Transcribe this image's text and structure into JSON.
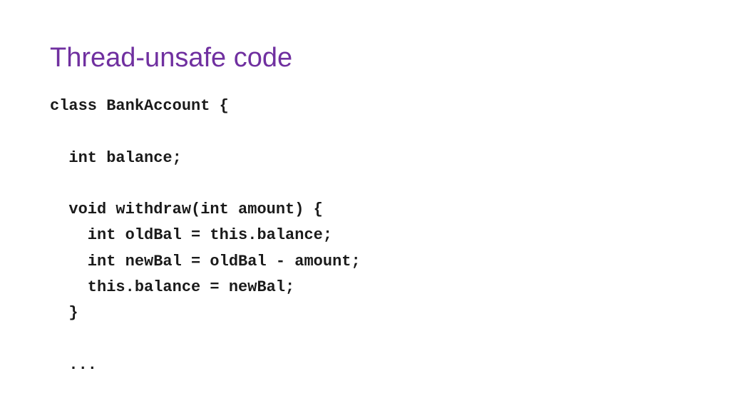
{
  "slide": {
    "title": "Thread-unsafe code",
    "code": "class BankAccount {\n\n  int balance;\n\n  void withdraw(int amount) {\n    int oldBal = this.balance;\n    int newBal = oldBal - amount;\n    this.balance = newBal;\n  }\n\n  ..."
  }
}
